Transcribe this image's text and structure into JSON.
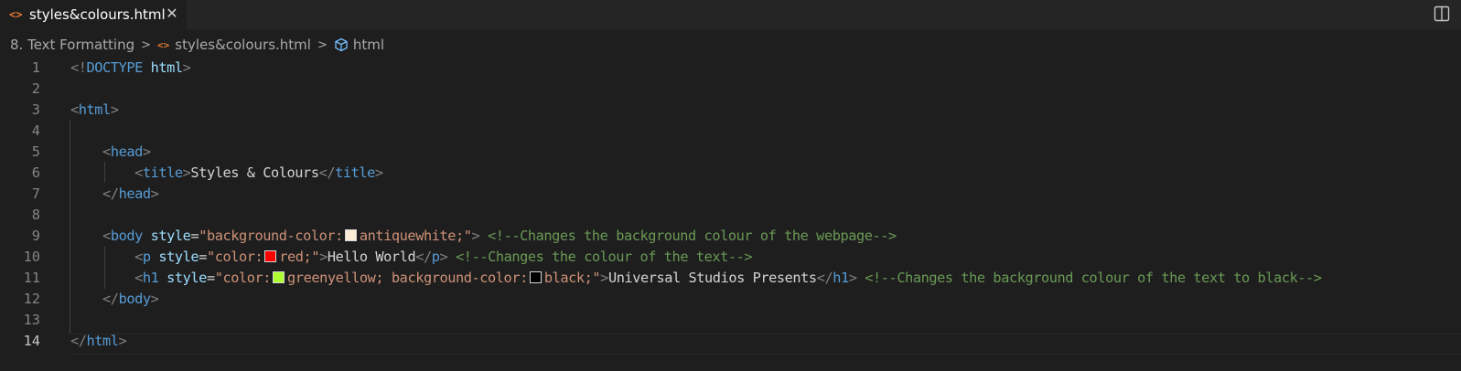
{
  "tab": {
    "icon": "<>",
    "label": "styles&colours.html",
    "close": "✕"
  },
  "icons": {
    "split_editor": "split-editor-icon",
    "html_file": "html-file-icon",
    "element": "symbol-element-icon"
  },
  "breadcrumb": {
    "folder": "8. Text Formatting",
    "file": "styles&colours.html",
    "symbol": "html",
    "separator": ">"
  },
  "editor": {
    "active_line": 14,
    "colors": {
      "antiquewhite": "#faebd7",
      "red": "#ff0000",
      "greenyellow": "#adff2f",
      "black": "#000000"
    },
    "lines": [
      {
        "n": "1",
        "tokens": [
          [
            "b",
            "<!"
          ],
          [
            "t",
            "DOCTYPE"
          ],
          [
            "x",
            " "
          ],
          [
            "a",
            "html"
          ],
          [
            "b",
            ">"
          ]
        ]
      },
      {
        "n": "2",
        "tokens": []
      },
      {
        "n": "3",
        "tokens": [
          [
            "b",
            "<"
          ],
          [
            "t",
            "html"
          ],
          [
            "b",
            ">"
          ]
        ]
      },
      {
        "n": "4",
        "tokens": []
      },
      {
        "n": "5",
        "tokens": [
          [
            "x",
            "    "
          ],
          [
            "b",
            "<"
          ],
          [
            "t",
            "head"
          ],
          [
            "b",
            ">"
          ]
        ]
      },
      {
        "n": "6",
        "tokens": [
          [
            "x",
            "        "
          ],
          [
            "b",
            "<"
          ],
          [
            "t",
            "title"
          ],
          [
            "b",
            ">"
          ],
          [
            "x",
            "Styles & Colours"
          ],
          [
            "b",
            "</"
          ],
          [
            "t",
            "title"
          ],
          [
            "b",
            ">"
          ]
        ]
      },
      {
        "n": "7",
        "tokens": [
          [
            "x",
            "    "
          ],
          [
            "b",
            "</"
          ],
          [
            "t",
            "head"
          ],
          [
            "b",
            ">"
          ]
        ]
      },
      {
        "n": "8",
        "tokens": []
      },
      {
        "n": "9",
        "tokens": [
          [
            "x",
            "    "
          ],
          [
            "b",
            "<"
          ],
          [
            "t",
            "body"
          ],
          [
            "x",
            " "
          ],
          [
            "a",
            "style"
          ],
          [
            "x",
            "="
          ],
          [
            "s",
            "\"background-color:"
          ],
          [
            "sw",
            "antiquewhite"
          ],
          [
            "s",
            "antiquewhite;\""
          ],
          [
            "b",
            ">"
          ],
          [
            "x",
            " "
          ],
          [
            "c",
            "<!--Changes the background colour of the webpage-->"
          ]
        ]
      },
      {
        "n": "10",
        "tokens": [
          [
            "x",
            "        "
          ],
          [
            "b",
            "<"
          ],
          [
            "t",
            "p"
          ],
          [
            "x",
            " "
          ],
          [
            "a",
            "style"
          ],
          [
            "x",
            "="
          ],
          [
            "s",
            "\"color:"
          ],
          [
            "sw",
            "red"
          ],
          [
            "s",
            "red;\""
          ],
          [
            "b",
            ">"
          ],
          [
            "x",
            "Hello World"
          ],
          [
            "b",
            "</"
          ],
          [
            "t",
            "p"
          ],
          [
            "b",
            ">"
          ],
          [
            "x",
            " "
          ],
          [
            "c",
            "<!--Changes the colour of the text-->"
          ]
        ]
      },
      {
        "n": "11",
        "tokens": [
          [
            "x",
            "        "
          ],
          [
            "b",
            "<"
          ],
          [
            "t",
            "h1"
          ],
          [
            "x",
            " "
          ],
          [
            "a",
            "style"
          ],
          [
            "x",
            "="
          ],
          [
            "s",
            "\"color:"
          ],
          [
            "sw",
            "greenyellow"
          ],
          [
            "s",
            "greenyellow; background-color:"
          ],
          [
            "sw",
            "black"
          ],
          [
            "s",
            "black;\""
          ],
          [
            "b",
            ">"
          ],
          [
            "x",
            "Universal Studios Presents"
          ],
          [
            "b",
            "</"
          ],
          [
            "t",
            "h1"
          ],
          [
            "b",
            ">"
          ],
          [
            "x",
            " "
          ],
          [
            "c",
            "<!--Changes the background colour of the text to black-->"
          ]
        ]
      },
      {
        "n": "12",
        "tokens": [
          [
            "x",
            "    "
          ],
          [
            "b",
            "</"
          ],
          [
            "t",
            "body"
          ],
          [
            "b",
            ">"
          ]
        ]
      },
      {
        "n": "13",
        "tokens": []
      },
      {
        "n": "14",
        "tokens": [
          [
            "b",
            "</"
          ],
          [
            "t",
            "html"
          ],
          [
            "b",
            ">"
          ]
        ]
      }
    ]
  }
}
